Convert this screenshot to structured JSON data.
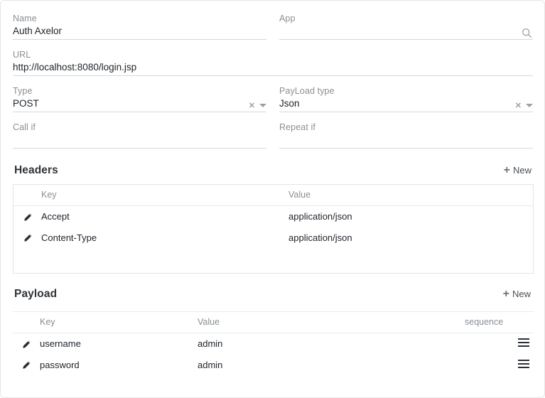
{
  "form": {
    "fields": [
      {
        "label": "Name",
        "value": "Auth Axelor",
        "adornments": []
      },
      {
        "label": "App",
        "value": "",
        "adornments": [
          "search-icon"
        ]
      },
      {
        "label": "URL",
        "value": "http://localhost:8080/login.jsp",
        "adornments": []
      },
      {
        "label": "Type",
        "value": "POST",
        "adornments": [
          "clear-icon",
          "chevron-down-icon"
        ]
      },
      {
        "label": "PayLoad type",
        "value": "Json",
        "adornments": [
          "clear-icon",
          "chevron-down-icon"
        ]
      },
      {
        "label": "Call if",
        "value": "",
        "adornments": []
      },
      {
        "label": "Repeat if",
        "value": "",
        "adornments": []
      }
    ]
  },
  "headers_section": {
    "title": "Headers",
    "new_label": "New",
    "columns": [
      "Key",
      "Value"
    ],
    "rows": [
      {
        "key": "Accept",
        "value": "application/json"
      },
      {
        "key": "Content-Type",
        "value": "application/json"
      }
    ]
  },
  "payload_section": {
    "title": "Payload",
    "new_label": "New",
    "columns": [
      "Key",
      "Value",
      "sequence"
    ],
    "rows": [
      {
        "key": "username",
        "value": "admin",
        "sequence": ""
      },
      {
        "key": "password",
        "value": "admin",
        "sequence": ""
      }
    ]
  },
  "colors": {
    "label": "#8a8f94",
    "value": "#20252b",
    "underline": "#d4d7da",
    "border": "#e2e4e6",
    "title": "#2f3438"
  }
}
